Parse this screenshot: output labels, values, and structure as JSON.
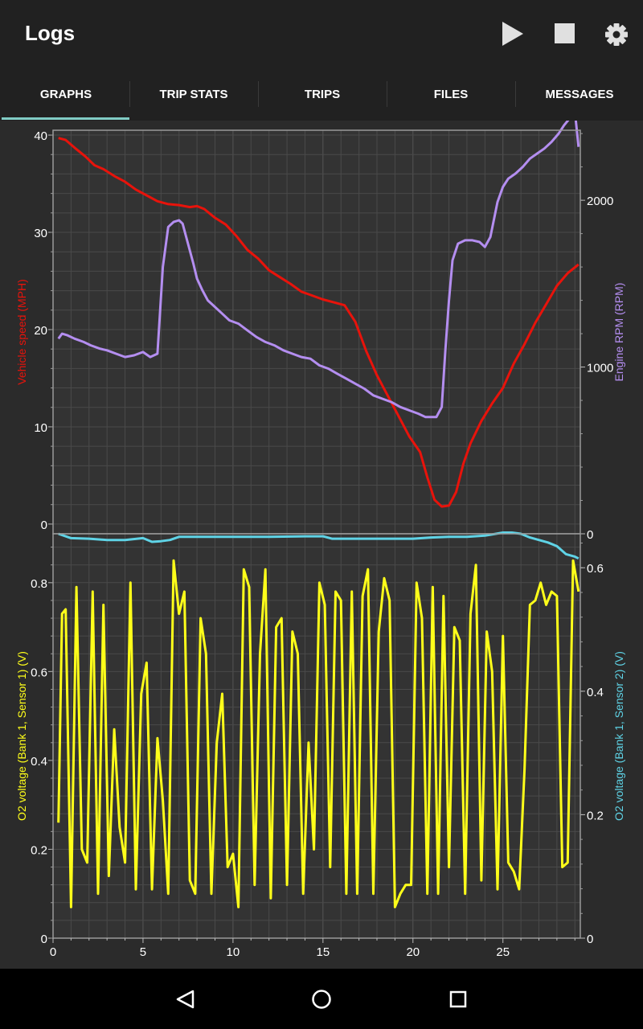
{
  "appbar": {
    "title": "Logs",
    "play_icon": "play-icon",
    "stop_icon": "stop-icon",
    "settings_icon": "gear-icon"
  },
  "tabs": [
    {
      "label": "GRAPHS",
      "selected": true
    },
    {
      "label": "TRIP STATS",
      "selected": false
    },
    {
      "label": "TRIPS",
      "selected": false
    },
    {
      "label": "FILES",
      "selected": false
    },
    {
      "label": "MESSAGES",
      "selected": false
    }
  ],
  "colors": {
    "accent": "#80cbc4",
    "speed": "#e8130b",
    "rpm": "#b48ef0",
    "o2s1": "#ffff1a",
    "o2s2": "#5fd3e6",
    "plot_bg": "#333333",
    "grid": "#4a4a4a"
  },
  "navbar": {
    "back_icon": "back-triangle-icon",
    "home_icon": "home-circle-icon",
    "recents_icon": "recents-square-icon"
  },
  "chart_data": [
    {
      "type": "line",
      "xlim": [
        0,
        29.3
      ],
      "y_left": {
        "label": "Vehicle speed (MPH)",
        "ylim": [
          -1,
          40.5
        ],
        "ticks": [
          0,
          10,
          20,
          30,
          40
        ]
      },
      "y_right": {
        "label": "Engine RPM (RPM)",
        "ylim": [
          0,
          2420
        ],
        "ticks": [
          0,
          1000,
          2000
        ]
      },
      "grid": true,
      "series": [
        {
          "name": "Vehicle speed (MPH)",
          "axis": "left",
          "x": [
            0.3,
            0.7,
            1.2,
            1.8,
            2.3,
            2.8,
            3.4,
            4.0,
            4.6,
            5.2,
            5.8,
            6.4,
            7.0,
            7.6,
            8.0,
            8.4,
            9.0,
            9.6,
            10.2,
            10.8,
            11.4,
            12.0,
            12.6,
            13.2,
            13.8,
            14.4,
            15.0,
            15.6,
            16.2,
            16.8,
            17.4,
            18.0,
            18.6,
            19.2,
            19.8,
            20.4,
            20.8,
            21.2,
            21.6,
            22.0,
            22.4,
            22.8,
            23.2,
            23.8,
            24.4,
            25.0,
            25.6,
            26.2,
            26.8,
            27.4,
            28.0,
            28.6,
            29.2
          ],
          "y": [
            39.7,
            39.5,
            38.7,
            37.8,
            36.9,
            36.5,
            35.8,
            35.2,
            34.4,
            33.8,
            33.2,
            32.9,
            32.8,
            32.6,
            32.7,
            32.4,
            31.5,
            30.8,
            29.6,
            28.2,
            27.3,
            26.1,
            25.4,
            24.7,
            23.9,
            23.5,
            23.1,
            22.8,
            22.5,
            20.8,
            17.8,
            15.3,
            13.2,
            11.1,
            9.0,
            7.4,
            4.8,
            2.5,
            1.8,
            1.9,
            3.3,
            6.2,
            8.3,
            10.6,
            12.4,
            14.0,
            16.5,
            18.5,
            20.7,
            22.6,
            24.5,
            25.8,
            26.7
          ]
        },
        {
          "name": "Engine RPM (RPM)",
          "axis": "right",
          "x": [
            0.3,
            0.5,
            0.8,
            1.2,
            1.7,
            2.1,
            2.6,
            3.0,
            3.5,
            4.0,
            4.5,
            5.0,
            5.4,
            5.8,
            6.1,
            6.4,
            6.7,
            7.0,
            7.2,
            7.5,
            7.8,
            8.0,
            8.3,
            8.6,
            9.0,
            9.4,
            9.8,
            10.3,
            10.8,
            11.3,
            11.8,
            12.3,
            12.8,
            13.3,
            13.8,
            14.3,
            14.8,
            15.3,
            15.8,
            16.3,
            16.8,
            17.3,
            17.8,
            18.3,
            18.8,
            19.3,
            19.8,
            20.3,
            20.7,
            21.0,
            21.3,
            21.6,
            21.8,
            22.0,
            22.2,
            22.5,
            22.9,
            23.3,
            23.7,
            24.0,
            24.3,
            24.7,
            25.0,
            25.3,
            25.7,
            26.1,
            26.5,
            26.9,
            27.3,
            27.7,
            28.1,
            28.4,
            28.7,
            29.0,
            29.2
          ],
          "y": [
            1170,
            1200,
            1190,
            1170,
            1150,
            1130,
            1110,
            1100,
            1080,
            1060,
            1070,
            1090,
            1060,
            1080,
            1600,
            1840,
            1870,
            1880,
            1860,
            1740,
            1620,
            1530,
            1460,
            1400,
            1360,
            1320,
            1280,
            1260,
            1220,
            1180,
            1150,
            1130,
            1100,
            1080,
            1060,
            1050,
            1010,
            990,
            960,
            930,
            900,
            870,
            830,
            810,
            790,
            760,
            740,
            720,
            700,
            700,
            700,
            760,
            1100,
            1400,
            1640,
            1740,
            1760,
            1760,
            1750,
            1720,
            1780,
            1990,
            2080,
            2130,
            2160,
            2200,
            2250,
            2280,
            2310,
            2350,
            2400,
            2450,
            2490,
            2530,
            2320
          ]
        }
      ]
    },
    {
      "type": "line",
      "xlim": [
        0,
        29.3
      ],
      "x_ticks": [
        0,
        5,
        10,
        15,
        20,
        25
      ],
      "y_left": {
        "label": "O2 voltage (Bank 1, Sensor 1) (V)",
        "ylim": [
          0,
          0.91
        ],
        "ticks": [
          0,
          0.2,
          0.4,
          0.6,
          0.8
        ]
      },
      "y_right": {
        "label": "O2 voltage (Bank 1, Sensor 2) (V)",
        "ylim": [
          0,
          0.655
        ],
        "ticks": [
          0,
          0.2,
          0.4,
          0.6
        ]
      },
      "grid": true,
      "series": [
        {
          "name": "O2 voltage (Bank 1, Sensor 1) (V)",
          "axis": "left",
          "x": [
            0.3,
            0.5,
            0.7,
            1.0,
            1.3,
            1.6,
            1.9,
            2.2,
            2.5,
            2.8,
            3.1,
            3.4,
            3.7,
            4.0,
            4.3,
            4.6,
            4.9,
            5.2,
            5.5,
            5.8,
            6.1,
            6.4,
            6.7,
            7.0,
            7.3,
            7.6,
            7.9,
            8.2,
            8.5,
            8.8,
            9.1,
            9.4,
            9.7,
            10.0,
            10.3,
            10.6,
            10.9,
            11.2,
            11.5,
            11.8,
            12.1,
            12.4,
            12.7,
            13.0,
            13.3,
            13.6,
            13.9,
            14.2,
            14.5,
            14.8,
            15.1,
            15.4,
            15.7,
            16.0,
            16.3,
            16.6,
            16.9,
            17.2,
            17.5,
            17.8,
            18.1,
            18.4,
            18.7,
            19.0,
            19.3,
            19.6,
            19.9,
            20.2,
            20.5,
            20.8,
            21.1,
            21.4,
            21.7,
            22.0,
            22.3,
            22.6,
            22.9,
            23.2,
            23.5,
            23.8,
            24.1,
            24.4,
            24.7,
            25.0,
            25.3,
            25.6,
            25.9,
            26.2,
            26.5,
            26.8,
            27.1,
            27.4,
            27.7,
            28.0,
            28.3,
            28.6,
            28.9,
            29.2
          ],
          "y": [
            0.26,
            0.73,
            0.74,
            0.07,
            0.79,
            0.2,
            0.17,
            0.78,
            0.1,
            0.75,
            0.14,
            0.47,
            0.25,
            0.17,
            0.8,
            0.11,
            0.55,
            0.62,
            0.11,
            0.45,
            0.31,
            0.1,
            0.85,
            0.73,
            0.78,
            0.13,
            0.1,
            0.72,
            0.64,
            0.1,
            0.44,
            0.55,
            0.16,
            0.19,
            0.07,
            0.83,
            0.79,
            0.12,
            0.64,
            0.83,
            0.09,
            0.7,
            0.72,
            0.12,
            0.69,
            0.64,
            0.1,
            0.44,
            0.2,
            0.8,
            0.75,
            0.16,
            0.78,
            0.76,
            0.1,
            0.78,
            0.1,
            0.77,
            0.83,
            0.1,
            0.69,
            0.81,
            0.76,
            0.07,
            0.1,
            0.12,
            0.12,
            0.8,
            0.72,
            0.1,
            0.79,
            0.1,
            0.77,
            0.16,
            0.7,
            0.67,
            0.1,
            0.73,
            0.84,
            0.13,
            0.69,
            0.6,
            0.11,
            0.68,
            0.17,
            0.15,
            0.11,
            0.38,
            0.75,
            0.76,
            0.8,
            0.75,
            0.78,
            0.77,
            0.16,
            0.17,
            0.85,
            0.78
          ]
        },
        {
          "name": "O2 voltage (Bank 1, Sensor 2) (V)",
          "axis": "right",
          "x": [
            0.3,
            1.0,
            2.0,
            3.0,
            4.0,
            5.0,
            5.5,
            6.0,
            6.5,
            7.0,
            8.0,
            10.0,
            12.0,
            14.0,
            15.0,
            15.5,
            16.0,
            17.0,
            18.0,
            19.0,
            20.0,
            21.0,
            22.0,
            23.0,
            24.0,
            25.0,
            25.5,
            26.0,
            26.5,
            27.0,
            27.5,
            28.0,
            28.5,
            29.0,
            29.2
          ],
          "y": [
            0.655,
            0.648,
            0.647,
            0.645,
            0.645,
            0.648,
            0.642,
            0.643,
            0.645,
            0.65,
            0.65,
            0.65,
            0.65,
            0.651,
            0.651,
            0.647,
            0.647,
            0.647,
            0.647,
            0.647,
            0.647,
            0.649,
            0.65,
            0.65,
            0.652,
            0.657,
            0.657,
            0.655,
            0.649,
            0.645,
            0.641,
            0.635,
            0.622,
            0.618,
            0.615
          ]
        }
      ]
    }
  ]
}
